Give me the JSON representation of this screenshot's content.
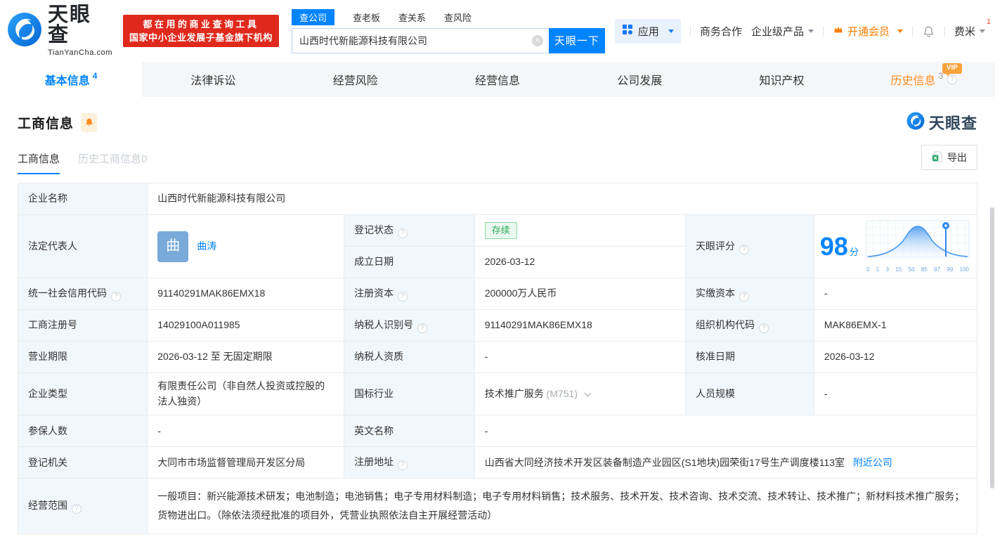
{
  "header": {
    "logo": {
      "brand": "天眼查",
      "domain": "TianYanCha.com"
    },
    "promo": {
      "line1": "都在用的商业查询工具",
      "line2": "国家中小企业发展子基金旗下机构"
    },
    "search": {
      "tabs": [
        {
          "label": "查公司"
        },
        {
          "label": "查老板"
        },
        {
          "label": "查关系"
        },
        {
          "label": "查风险"
        }
      ],
      "value": "山西时代新能源科技有限公司",
      "button_label": "天眼一下"
    },
    "nav": {
      "apps_label": "应用",
      "biz_coop": "商务合作",
      "enterprise_products": "企业级产品",
      "vip_label": "开通会员",
      "user_name": "费米",
      "notice_count": "1"
    }
  },
  "tabs": [
    {
      "label": "基本信息",
      "count": "4"
    },
    {
      "label": "法律诉讼"
    },
    {
      "label": "经营风险"
    },
    {
      "label": "经营信息"
    },
    {
      "label": "公司发展"
    },
    {
      "label": "知识产权"
    },
    {
      "label": "历史信息",
      "count": "3",
      "vip_badge": "VIP"
    }
  ],
  "section": {
    "title": "工商信息",
    "watermark": "天眼查",
    "subtabs": [
      {
        "label": "工商信息"
      },
      {
        "label": "历史工商信息0"
      }
    ],
    "export_label": "导出"
  },
  "table": {
    "company_name": {
      "label": "企业名称",
      "value": "山西时代新能源科技有限公司"
    },
    "legal_rep": {
      "label": "法定代表人",
      "avatar_char": "曲",
      "name": "曲涛"
    },
    "reg_status": {
      "label": "登记状态",
      "value": "存续"
    },
    "establish_date": {
      "label": "成立日期",
      "value": "2026-03-12"
    },
    "tyc_score": {
      "label": "天眼评分"
    },
    "credit_code": {
      "label": "统一社会信用代码",
      "value": "91140291MAK86EMX18"
    },
    "reg_capital": {
      "label": "注册资本",
      "value": "200000万人民币"
    },
    "paid_capital": {
      "label": "实缴资本",
      "value": "-"
    },
    "reg_number": {
      "label": "工商注册号",
      "value": "14029100A011985"
    },
    "taxpayer_id": {
      "label": "纳税人识别号",
      "value": "91140291MAK86EMX18"
    },
    "org_code": {
      "label": "组织机构代码",
      "value": "MAK86EMX-1"
    },
    "business_term": {
      "label": "营业期限",
      "value": "2026-03-12 至 无固定期限"
    },
    "taxpayer_quali": {
      "label": "纳税人资质",
      "value": "-"
    },
    "approval_date": {
      "label": "核准日期",
      "value": "2026-03-12"
    },
    "company_type": {
      "label": "企业类型",
      "value": "有限责任公司（非自然人投资或控股的法人独资）"
    },
    "industry": {
      "label": "国标行业",
      "value": "技术推广服务",
      "code": "(M751)"
    },
    "staff_size": {
      "label": "人员规模",
      "value": "-"
    },
    "insured_count": {
      "label": "参保人数",
      "value": "-"
    },
    "english_name": {
      "label": "英文名称",
      "value": "-"
    },
    "reg_authority": {
      "label": "登记机关",
      "value": "大同市市场监督管理局开发区分局"
    },
    "reg_address": {
      "label": "注册地址",
      "value": "山西省大同经济技术开发区装备制造产业园区(S1地块)园荣街17号生产调度楼113室",
      "link": "附近公司"
    },
    "business_scope": {
      "label": "经营范围",
      "value": "一般项目：新兴能源技术研发；电池制造；电池销售；电子专用材料制造；电子专用材料销售；技术服务、技术开发、技术咨询、技术交流、技术转让、技术推广；新材料技术推广服务；货物进出口。（除依法须经批准的项目外，凭营业执照依法自主开展经营活动）"
    }
  },
  "chart_data": {
    "type": "area",
    "title": "天眼评分",
    "score": "98",
    "score_unit": "分",
    "x_ticks": [
      "0",
      "1",
      "3",
      "15",
      "50",
      "85",
      "97",
      "99",
      "100"
    ],
    "marker_value": 98,
    "relative_heights": [
      0.03,
      0.07,
      0.18,
      0.55,
      1.0,
      0.55,
      0.18,
      0.07,
      0.03
    ],
    "grid": true,
    "legend": false
  },
  "colors": {
    "brand_blue": "#0084ff",
    "promo_red": "#e0291d",
    "vip_orange": "#ff7d00",
    "history_tab_orange": "#ff8a1e",
    "status_green": "#2ba75a",
    "label_cell_bg": "#f1f8fd"
  }
}
